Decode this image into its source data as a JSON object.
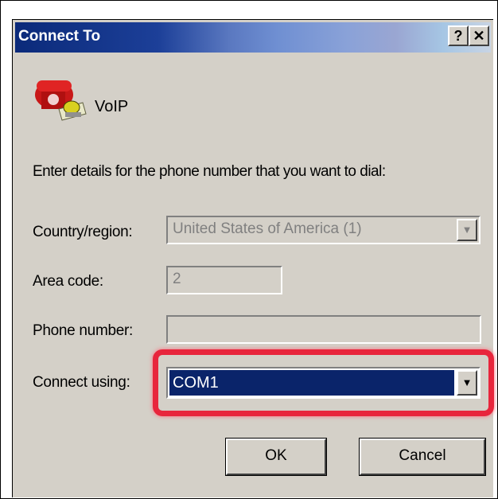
{
  "window": {
    "title": "Connect To",
    "help_glyph": "?",
    "close_glyph": "✕"
  },
  "entry": {
    "name": "VoIP",
    "icon": "telephone-icon"
  },
  "instructions": "Enter details for the phone number that you want to dial:",
  "fields": {
    "country": {
      "label": "Country/region:",
      "value": "United States of America (1)",
      "enabled": false
    },
    "area_code": {
      "label": "Area code:",
      "value": "2",
      "enabled": false
    },
    "phone_number": {
      "label": "Phone number:",
      "value": "",
      "enabled": false
    },
    "connect_using": {
      "label": "Connect using:",
      "value": "COM1",
      "enabled": true
    }
  },
  "buttons": {
    "ok": "OK",
    "cancel": "Cancel"
  },
  "colors": {
    "highlight": "#e8253c",
    "selection": "#0a246a",
    "dialog": "#d4d0c8"
  }
}
